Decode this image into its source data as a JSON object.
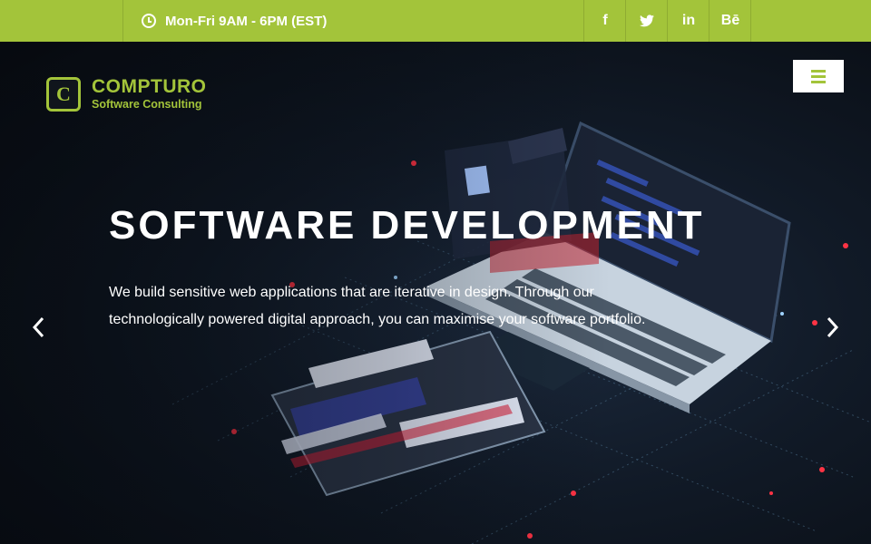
{
  "topbar": {
    "hours": "Mon-Fri 9AM - 6PM (EST)",
    "social": [
      {
        "icon": "facebook-icon",
        "label": "f"
      },
      {
        "icon": "twitter-icon",
        "label": "𝕥"
      },
      {
        "icon": "linkedin-icon",
        "label": "in"
      },
      {
        "icon": "behance-icon",
        "label": "Bē"
      }
    ]
  },
  "logo": {
    "letter": "C",
    "name": "COMPTURO",
    "tagline": "Software Consulting"
  },
  "hero": {
    "title": "SOFTWARE DEVELOPMENT",
    "description": "We build sensitive web applications that are iterative in design. Through our technologically powered digital approach, you can maximise your software portfolio."
  },
  "colors": {
    "accent": "#a3c43a",
    "background": "#0c1119",
    "text": "#ffffff"
  }
}
